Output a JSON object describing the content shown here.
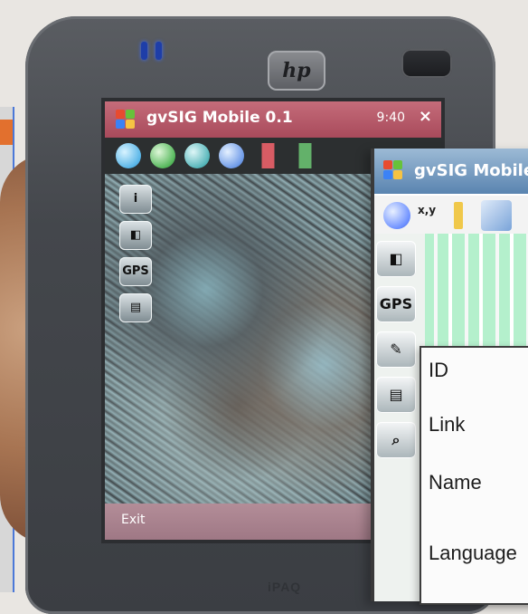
{
  "left_window": {
    "accent_color": "#4b78d8",
    "bar_color": "#e2702e"
  },
  "device": {
    "brand_logo": "hp",
    "label": "iPAQ",
    "body_color": "#44474c"
  },
  "app_main": {
    "title": "gvSIG Mobile 0.1",
    "status": "9:40",
    "close_label": "×",
    "gps_label": "GPS",
    "menu_label": "Exit",
    "icons": {
      "start": "windows-flag-icon",
      "zoom": "zoom-icon",
      "zoom_in": "zoom-in-icon",
      "zoom_out": "zoom-out-icon",
      "pan": "pan-icon",
      "back": "back-arrow-icon",
      "forward": "forward-arrow-icon",
      "info": "info-icon",
      "layers": "layers-icon",
      "gps": "gps-icon",
      "table": "table-icon"
    }
  },
  "app_secondary": {
    "title": "gvSIG Mobile",
    "toolbar": {
      "coord_label": "x,y",
      "gps_label": "GPS"
    },
    "popup_fields": [
      "ID",
      "Link",
      "Name",
      "Language"
    ],
    "icons": {
      "start": "windows-flag-icon",
      "info": "info-icon",
      "coordinate": "coordinate-icon",
      "measure": "measure-icon",
      "layers": "layers-icon",
      "gps": "gps-icon",
      "edit": "edit-icon",
      "table": "table-icon",
      "search": "search-icon"
    }
  },
  "colors": {
    "main_titlebar": "#a84a5b",
    "secondary_titlebar": "#5a84b0",
    "map_secondary_bg": "#baf2cf",
    "map_lines": "#f6f7f7"
  }
}
